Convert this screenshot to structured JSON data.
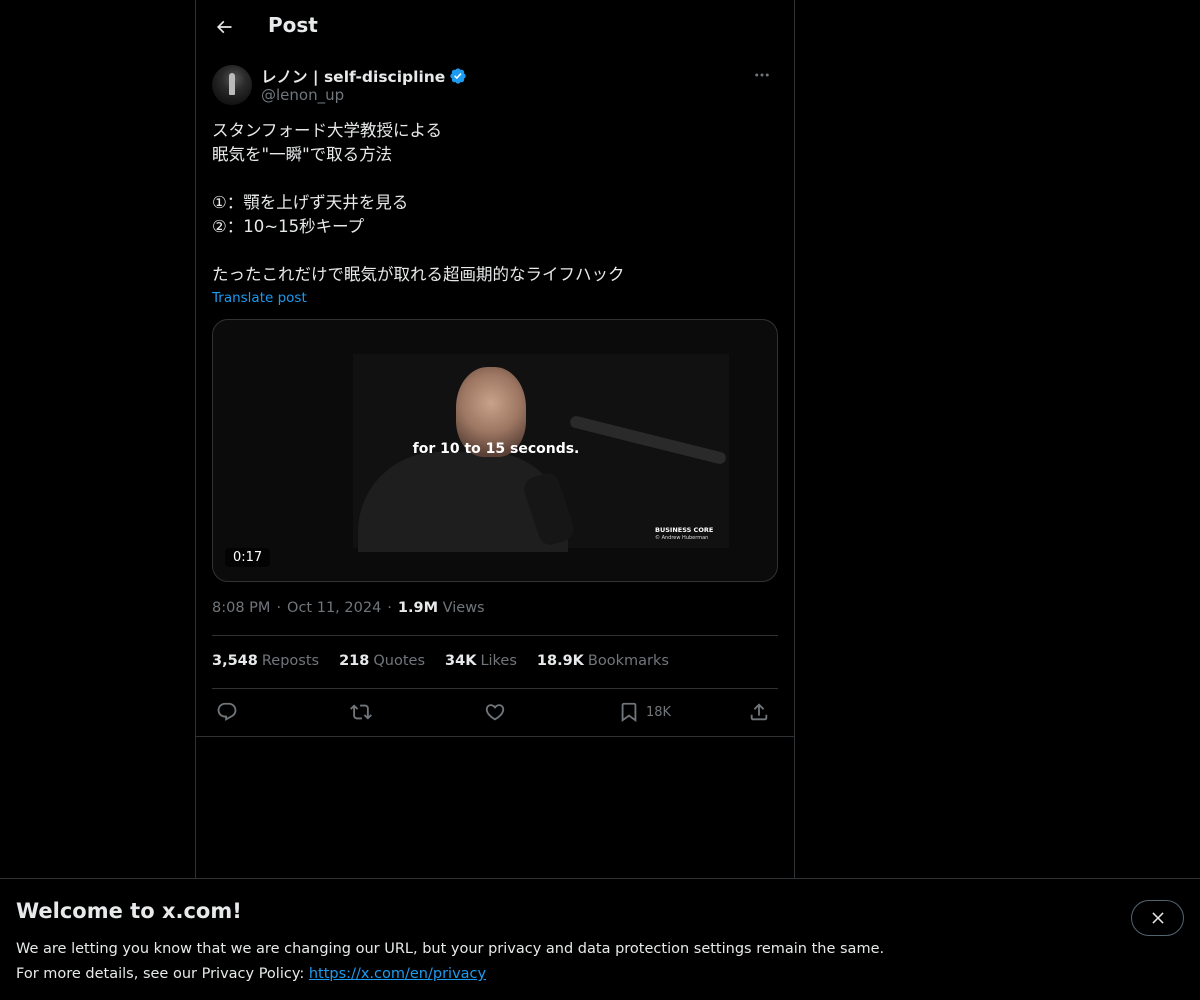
{
  "header": {
    "title": "Post",
    "back_icon": "arrow-left-icon"
  },
  "author": {
    "display_name": "レノン | self-discipline",
    "handle": "@lenon_up",
    "verified": true,
    "verified_color": "#1d9bf0"
  },
  "post": {
    "lines": [
      "スタンフォード大学教授による",
      "眠気を\"一瞬\"で取る方法",
      "",
      "①：顎を上げず天井を見る",
      "②：10~15秒キープ",
      "",
      "たったこれだけで眠気が取れる超画期的なライフハック"
    ],
    "translate_label": "Translate post"
  },
  "media": {
    "caption": "for 10 to 15 seconds.",
    "brand_title": "BUSINESS CORE",
    "brand_sub": "© Andrew Huberman",
    "duration": "0:17"
  },
  "meta": {
    "time": "8:08 PM",
    "separator": "·",
    "date": "Oct 11, 2024",
    "views_count": "1.9M",
    "views_label": "Views"
  },
  "stats": [
    {
      "count": "3,548",
      "label": "Reposts"
    },
    {
      "count": "218",
      "label": "Quotes"
    },
    {
      "count": "34K",
      "label": "Likes"
    },
    {
      "count": "18.9K",
      "label": "Bookmarks"
    }
  ],
  "actions": {
    "reply_icon": "reply-icon",
    "repost_icon": "repost-icon",
    "like_icon": "heart-icon",
    "bookmark_icon": "bookmark-icon",
    "bookmark_count": "18K",
    "share_icon": "share-icon"
  },
  "banner": {
    "title": "Welcome to x.com!",
    "line1": "We are letting you know that we are changing our URL, but your privacy and data protection settings remain the same.",
    "line2_prefix": "For more details, see our Privacy Policy: ",
    "link": "https://x.com/en/privacy"
  },
  "colors": {
    "background": "#000000",
    "text": "#e7e9ea",
    "muted": "#71767b",
    "accent": "#1d9bf0",
    "border": "#2f3336"
  }
}
